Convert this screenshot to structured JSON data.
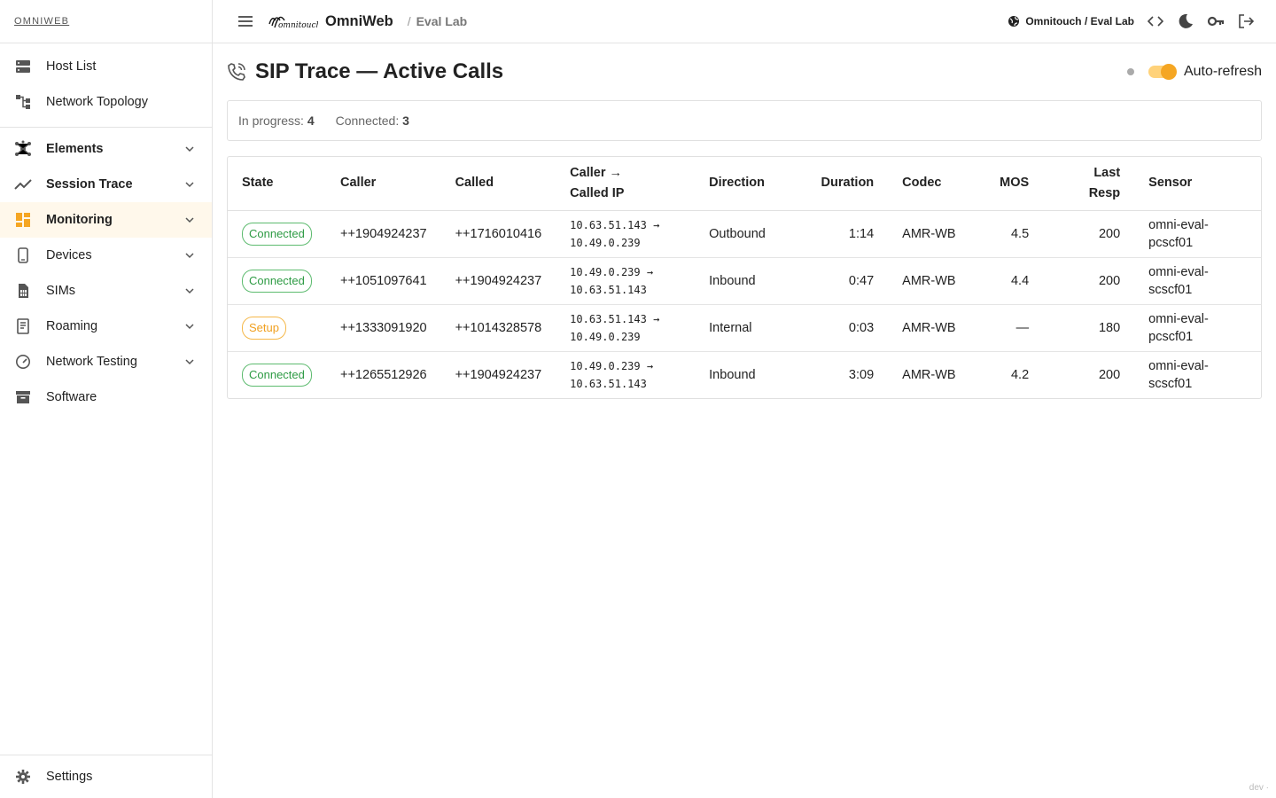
{
  "brand": "OMNIWEB",
  "sidebar": {
    "top_items": [
      {
        "label": "Host List",
        "icon": "server-icon"
      },
      {
        "label": "Network Topology",
        "icon": "topology-icon"
      }
    ],
    "groups": [
      {
        "label": "Elements",
        "icon": "molecule-icon",
        "bold": true
      },
      {
        "label": "Session Trace",
        "icon": "trend-icon",
        "bold": true
      },
      {
        "label": "Monitoring",
        "icon": "dashboard-icon",
        "bold": true,
        "active": true
      },
      {
        "label": "Devices",
        "icon": "phone-icon"
      },
      {
        "label": "SIMs",
        "icon": "sim-icon"
      },
      {
        "label": "Roaming",
        "icon": "book-icon"
      },
      {
        "label": "Network Testing",
        "icon": "gauge-icon"
      },
      {
        "label": "Software",
        "icon": "archive-icon"
      }
    ],
    "settings_label": "Settings"
  },
  "header": {
    "app_name": "OmniWeb",
    "breadcrumb_sep": "/",
    "breadcrumb": "Eval Lab",
    "tenant": "Omnitouch / Eval Lab"
  },
  "page": {
    "title": "SIP Trace — Active Calls",
    "auto_refresh_label": "Auto-refresh",
    "auto_refresh_on": true
  },
  "summary": {
    "in_progress_label": "In progress:",
    "in_progress": "4",
    "connected_label": "Connected:",
    "connected": "3"
  },
  "table": {
    "headers": {
      "state": "State",
      "caller": "Caller",
      "called": "Called",
      "ip_1": "Caller →",
      "ip_2": "Called IP",
      "direction": "Direction",
      "duration": "Duration",
      "codec": "Codec",
      "mos": "MOS",
      "resp_1": "Last",
      "resp_2": "Resp",
      "sensor": "Sensor"
    },
    "rows": [
      {
        "state": "Connected",
        "state_color": "#2e9b44",
        "caller": "++1904924237",
        "called": "++1716010416",
        "ip_from": "10.63.51.143 →",
        "ip_to": "10.49.0.239",
        "direction": "Outbound",
        "duration": "1:14",
        "codec": "AMR-WB",
        "mos": "4.5",
        "resp": "200",
        "sensor_1": "omni-eval-",
        "sensor_2": "pcscf01"
      },
      {
        "state": "Connected",
        "state_color": "#2e9b44",
        "caller": "++1051097641",
        "called": "++1904924237",
        "ip_from": "10.49.0.239 →",
        "ip_to": "10.63.51.143",
        "direction": "Inbound",
        "duration": "0:47",
        "codec": "AMR-WB",
        "mos": "4.4",
        "resp": "200",
        "sensor_1": "omni-eval-",
        "sensor_2": "scscf01"
      },
      {
        "state": "Setup",
        "state_color": "#f0a020",
        "caller": "++1333091920",
        "called": "++1014328578",
        "ip_from": "10.63.51.143 →",
        "ip_to": "10.49.0.239",
        "direction": "Internal",
        "duration": "0:03",
        "codec": "AMR-WB",
        "mos": "—",
        "resp": "180",
        "sensor_1": "omni-eval-",
        "sensor_2": "pcscf01"
      },
      {
        "state": "Connected",
        "state_color": "#2e9b44",
        "caller": "++1265512926",
        "called": "++1904924237",
        "ip_from": "10.49.0.239 →",
        "ip_to": "10.63.51.143",
        "direction": "Inbound",
        "duration": "3:09",
        "codec": "AMR-WB",
        "mos": "4.2",
        "resp": "200",
        "sensor_1": "omni-eval-",
        "sensor_2": "scscf01"
      }
    ]
  },
  "footer_tag": "dev ·"
}
